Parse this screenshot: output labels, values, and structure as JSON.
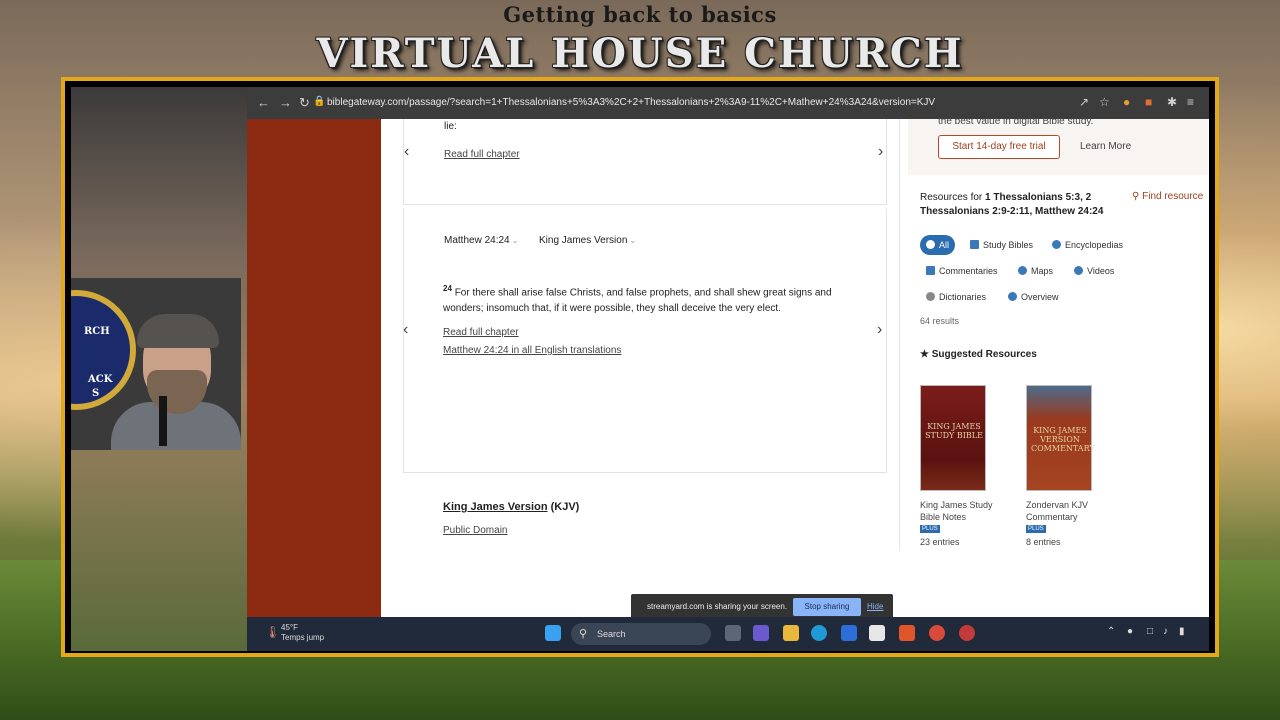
{
  "banner": {
    "subtitle": "Getting back to basics",
    "title": "VIRTUAL HOUSE CHURCH"
  },
  "webcam": {
    "seal_text_1": "RCH",
    "seal_text_2": "ACK",
    "seal_text_3": "S"
  },
  "browser": {
    "url": "biblegateway.com/passage/?search=1+Thessalonians+5%3A3%2C+2+Thessalonians+2%3A9-11%2C+Mathew+24%3A24&version=KJV",
    "icons": [
      "back-icon",
      "forward-icon",
      "reload-icon",
      "lock-icon",
      "share-icon",
      "star-icon",
      "extension-icon",
      "extension-icon",
      "puzzle-icon",
      "menu-icon"
    ]
  },
  "passage": {
    "prev_fragment": "lie:",
    "read_full_chapter_1": "Read full chapter",
    "ref": "Matthew 24:24",
    "version": "King James Version",
    "verse_num": "24",
    "verse_text": "For there shall arise false Christs, and false prophets, and shall shew great signs and wonders; insomuch that, if it were possible, they shall deceive the very elect.",
    "read_full_chapter_2": "Read full chapter",
    "all_translations": "Matthew 24:24 in all English translations",
    "kjv_name": "King James Version",
    "kjv_abbr": "(KJV)",
    "public_domain": "Public Domain"
  },
  "panel": {
    "promo_text": "the best value in digital Bible study.",
    "trial_button": "Start 14-day free trial",
    "learn_more": "Learn More",
    "resources_prefix": "Resources for ",
    "resources_refs": "1 Thessalonians 5:3, 2 Thessalonians 2:9-2:11, Matthew 24:24",
    "find_resource": "Find resource",
    "chips": [
      "All",
      "Study Bibles",
      "Encyclopedias",
      "Commentaries",
      "Maps",
      "Videos",
      "Dictionaries",
      "Overview"
    ],
    "results": "64 results",
    "suggested": "Suggested Resources",
    "books": [
      {
        "cover": "KING JAMES STUDY BIBLE",
        "name": "King James Study Bible Notes",
        "badge": "PLUS",
        "entries": "23 entries"
      },
      {
        "cover": "KING JAMES VERSION COMMENTARY",
        "name": "Zondervan KJV Commentary",
        "badge": "PLUS",
        "entries": "8 entries"
      }
    ]
  },
  "share_bar": {
    "message": "streamyard.com is sharing your screen.",
    "stop": "Stop sharing",
    "hide": "Hide"
  },
  "taskbar": {
    "temp": "45°F",
    "weather_desc": "Temps jump",
    "search": "Search",
    "accent": "#2b6cb0"
  }
}
